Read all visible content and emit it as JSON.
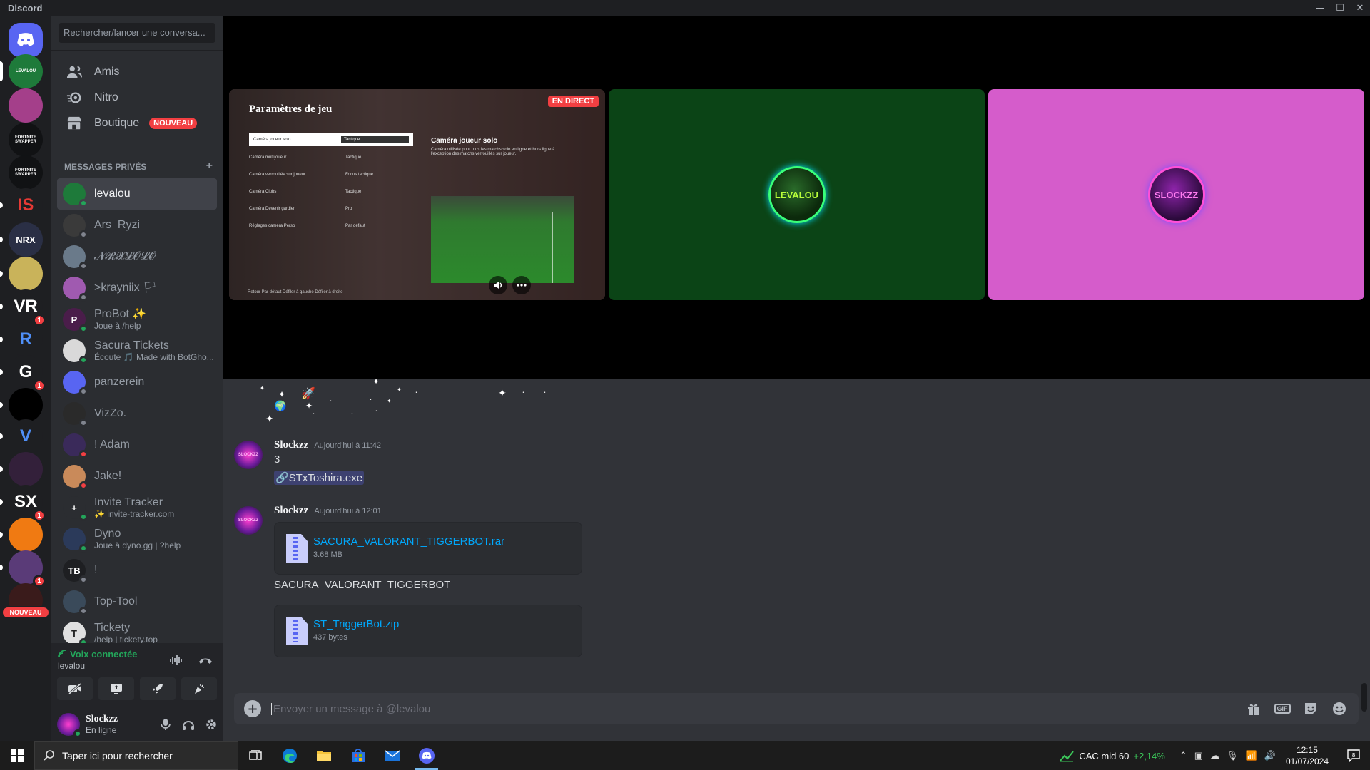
{
  "window": {
    "title": "Discord",
    "controls": [
      "—",
      "☐",
      "✕"
    ]
  },
  "servers": [
    {
      "name": "Discord home",
      "label": "",
      "badge": "",
      "color": "#5865f2"
    },
    {
      "name": "levalou",
      "label": "LEVALOU",
      "badge": "",
      "color": "#1e7a3a"
    },
    {
      "name": "server-pink",
      "label": "",
      "badge": "",
      "color": "#a43f8a"
    },
    {
      "name": "fortnite-swapper-1",
      "label": "FORTNITE SWAPPER",
      "badge": "",
      "color": "#111214"
    },
    {
      "name": "fortnite-swapper-2",
      "label": "FORTNITE SWAPPER",
      "badge": "",
      "color": "#111214"
    },
    {
      "name": "server-is",
      "label": "IS",
      "badge": "",
      "color": "#1e1f22"
    },
    {
      "name": "server-nrx",
      "label": "NRX",
      "badge": "",
      "color": "#2a2f45"
    },
    {
      "name": "server-yellow",
      "label": "",
      "badge": "",
      "color": "#c9b35a"
    },
    {
      "name": "server-vr",
      "label": "VR",
      "badge": "1",
      "color": "#1e1f22"
    },
    {
      "name": "server-r",
      "label": "R",
      "badge": "",
      "color": "#1e1f22"
    },
    {
      "name": "server-g",
      "label": "G",
      "badge": "1",
      "color": "#1e1f22"
    },
    {
      "name": "server-globe",
      "label": "",
      "badge": "",
      "color": "#000000"
    },
    {
      "name": "server-v",
      "label": "V",
      "badge": "",
      "color": "#1e1f22"
    },
    {
      "name": "server-shield",
      "label": "",
      "badge": "",
      "color": "#33203a"
    },
    {
      "name": "server-sx",
      "label": "SX",
      "badge": "1",
      "color": "#1e1f22"
    },
    {
      "name": "server-orange",
      "label": "",
      "badge": "",
      "color": "#f07a12"
    },
    {
      "name": "server-wolf",
      "label": "",
      "badge": "1",
      "color": "#5a3b78"
    },
    {
      "name": "server-nouveau",
      "label": "",
      "badge": "NOUVEAU",
      "color": "#3a1b1b"
    }
  ],
  "sidebar": {
    "search_placeholder": "Rechercher/lancer une conversa...",
    "nav": [
      {
        "label": "Amis",
        "icon": "friends-icon",
        "badge": ""
      },
      {
        "label": "Nitro",
        "icon": "nitro-icon",
        "badge": ""
      },
      {
        "label": "Boutique",
        "icon": "shop-icon",
        "badge": "NOUVEAU"
      }
    ],
    "dm_header": "MESSAGES PRIVÉS",
    "dm_add": "+",
    "dms": [
      {
        "name": "levalou",
        "sub": "",
        "status": "online",
        "color": "#1e7a3a",
        "initials": "",
        "active": true
      },
      {
        "name": "Ars_Ryzi",
        "sub": "",
        "status": "idle",
        "color": "#3a3a3a",
        "initials": "",
        "active": false
      },
      {
        "name": "𝓝𝓡𝓧𝓛𝓞𝓛𝓞",
        "sub": "",
        "status": "idle",
        "color": "#6a7a8a",
        "initials": "",
        "active": false
      },
      {
        "name": ">krayniix 🏳",
        "sub": "",
        "status": "idle",
        "color": "#a05ab0",
        "initials": "",
        "active": false
      },
      {
        "name": "ProBot ✨",
        "sub": "Joue à /help",
        "status": "online",
        "color": "#4a1d4a",
        "initials": "P",
        "active": false
      },
      {
        "name": "Sacura Tickets",
        "sub": "Écoute 🎵 Made with BotGho...",
        "status": "online",
        "color": "#d9d9d9",
        "initials": "",
        "active": false
      },
      {
        "name": "panzerein",
        "sub": "",
        "status": "idle",
        "color": "#5865f2",
        "initials": "",
        "active": false
      },
      {
        "name": "VizZo.",
        "sub": "",
        "status": "idle",
        "color": "#2a2a2a",
        "initials": "",
        "active": false
      },
      {
        "name": "! Adam",
        "sub": "",
        "status": "dnd",
        "color": "#3a2a5a",
        "initials": "",
        "active": false
      },
      {
        "name": "Jake!",
        "sub": "",
        "status": "dnd",
        "color": "#c98a5a",
        "initials": "",
        "active": false
      },
      {
        "name": "Invite Tracker",
        "sub": "✨ invite-tracker.com",
        "status": "online",
        "color": "#2b2d31",
        "initials": "+",
        "active": false
      },
      {
        "name": "Dyno",
        "sub": "Joue à dyno.gg | ?help",
        "status": "online",
        "color": "#2b3a5a",
        "initials": "",
        "active": false
      },
      {
        "name": "!",
        "sub": "",
        "status": "idle",
        "color": "#1e1f22",
        "initials": "TB",
        "active": false
      },
      {
        "name": "Top-Tool",
        "sub": "",
        "status": "idle",
        "color": "#3a4a5a",
        "initials": "",
        "active": false
      },
      {
        "name": "Tickety",
        "sub": "/help | tickety.top",
        "status": "online",
        "color": "#e0e0e0",
        "initials": "T",
        "active": false
      }
    ],
    "voice": {
      "status": "Voix connectée",
      "channel": "levalou"
    },
    "user": {
      "name": "Slockzz",
      "status": "En ligne"
    }
  },
  "stage": {
    "stream_tile": {
      "live_badge": "EN DIRECT",
      "title": "Paramètres de jeu",
      "menu_rows": [
        [
          "Caméra joueur solo",
          "Tactique"
        ],
        [
          "Caméra multijoueur",
          "Tactique"
        ],
        [
          "Caméra verrouillée sur joueur",
          "Focus tactique"
        ],
        [
          "Caméra Clubs",
          "Tactique"
        ],
        [
          "Caméra Devenir gardien",
          "Pro"
        ],
        [
          "Réglages caméra Perso",
          "Par défaut"
        ]
      ],
      "right_title": "Caméra joueur solo",
      "right_desc": "Caméra utilisée pour tous les matchs solo en ligne et hors ligne à l'exception des matchs verrouillés sur joueur.",
      "footer": "Retour   Par défaut   Défiler à gauche   Défiler à droite"
    },
    "tiles": [
      {
        "name": "levalou",
        "label": "LEVALOU"
      },
      {
        "name": "slockzz",
        "label": "SLOCKZZ"
      }
    ]
  },
  "chat": {
    "messages": [
      {
        "author": "Slockzz",
        "time": "Aujourd'hui à 11:42",
        "text": "3",
        "link": "🔗STxToshira.exe"
      },
      {
        "author": "Slockzz",
        "time": "Aujourd'hui à 12:01",
        "attachments": [
          {
            "name": "SACURA_VALORANT_TIGGERBOT.rar",
            "size": "3.68 MB"
          }
        ],
        "text": "SACURA_VALORANT_TIGGERBOT",
        "attachments2": [
          {
            "name": "ST_TriggerBot.zip",
            "size": "437 bytes"
          }
        ]
      }
    ],
    "avatar_label": "SLOCKZZ",
    "composer_placeholder": "Envoyer un message à @levalou",
    "composer_gif": "GIF"
  },
  "taskbar": {
    "search_placeholder": "Taper ici pour rechercher",
    "stock_name": "CAC mid 60",
    "stock_change": "+2,14%",
    "time": "12:15",
    "date": "01/07/2024",
    "notif_count": "8"
  }
}
